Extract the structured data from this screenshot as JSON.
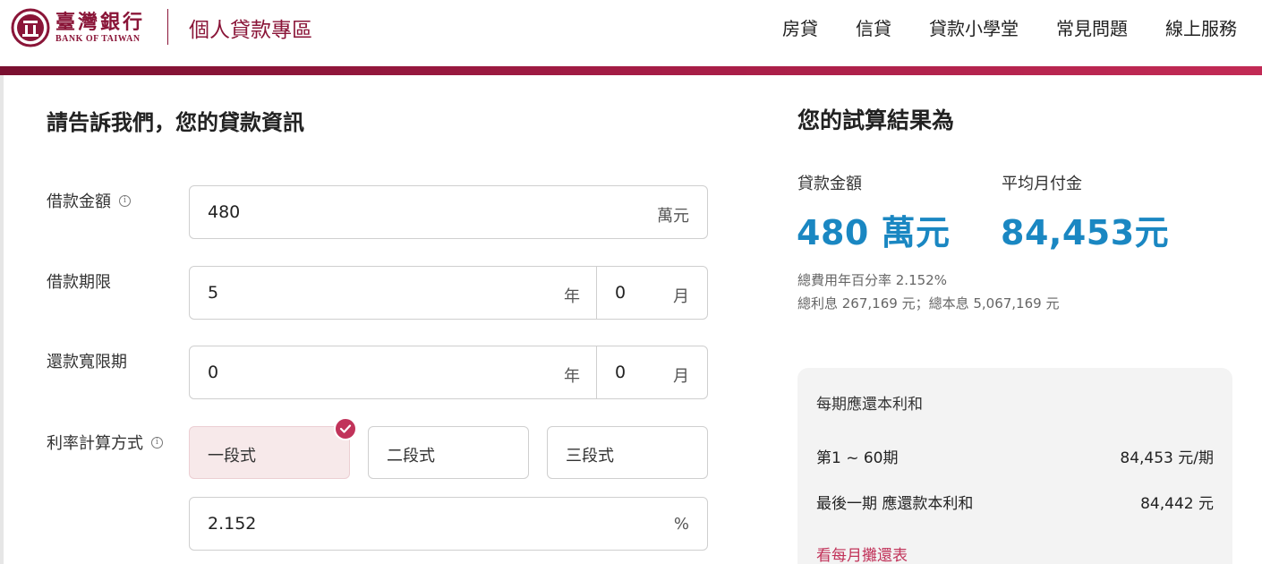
{
  "header": {
    "logo_cn": "臺灣銀行",
    "logo_en": "BANK OF TAIWAN",
    "zone_title": "個人貸款專區",
    "nav": [
      "房貸",
      "信貸",
      "貸款小學堂",
      "常見問題",
      "線上服務"
    ]
  },
  "form": {
    "title": "請告訴我們，您的貸款資訊",
    "amount": {
      "label": "借款金額",
      "value": "480",
      "unit": "萬元"
    },
    "term": {
      "label": "借款期限",
      "years": "5",
      "year_unit": "年",
      "months": "0",
      "month_unit": "月"
    },
    "grace": {
      "label": "還款寬限期",
      "years": "0",
      "year_unit": "年",
      "months": "0",
      "month_unit": "月"
    },
    "rate_method": {
      "label": "利率計算方式",
      "options": [
        "一段式",
        "二段式",
        "三段式"
      ],
      "selected": "一段式"
    },
    "rate": {
      "value": "2.152",
      "unit": "%"
    }
  },
  "result": {
    "title": "您的試算結果為",
    "loan_amount_label": "貸款金額",
    "loan_amount_value": "480 萬元",
    "monthly_label": "平均月付金",
    "monthly_value": "84,453元",
    "apr_note": "總費用年百分率 2.152%",
    "interest_note": "總利息 267,169 元；總本息 5,067,169 元"
  },
  "schedule": {
    "title": "每期應還本利和",
    "rows": [
      {
        "label": "第1 ~ 60期",
        "value": "84,453 元/期"
      },
      {
        "label": "最後一期 應還款本利和",
        "value": "84,442 元"
      }
    ],
    "link": "看每月攤還表"
  },
  "colors": {
    "brand": "#8a1538",
    "accent": "#c1335a",
    "result_blue": "#1a87c2"
  }
}
